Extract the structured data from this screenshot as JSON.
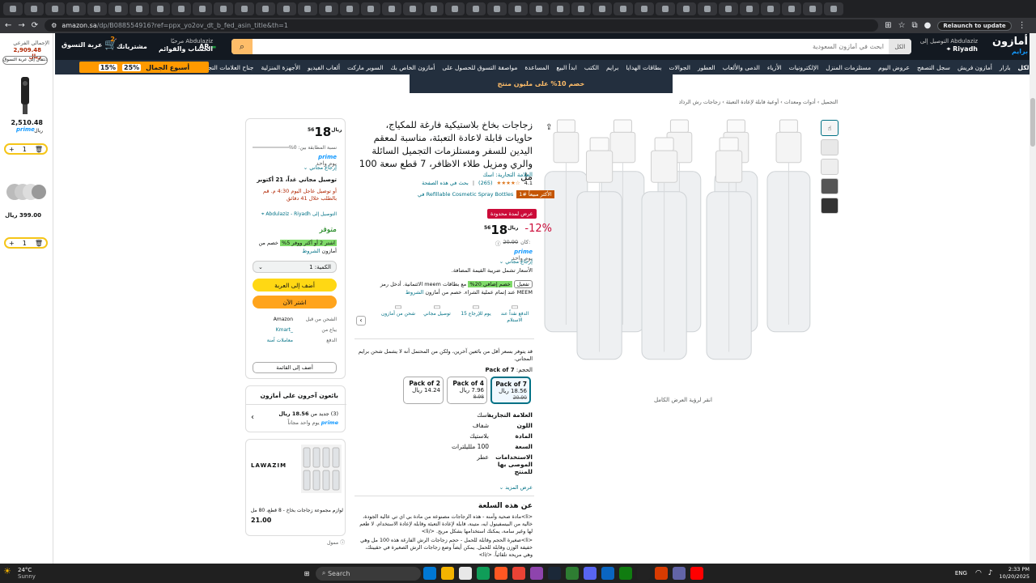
{
  "browser": {
    "url_host": "amazon.sa",
    "url_path": "/dp/B088554916?ref=ppx_yo2ov_dt_b_fed_asin_title&th=1",
    "relaunch": "Relaunch to update",
    "tab_count": 40
  },
  "header": {
    "logo": "أمازون",
    "prime_logo": "برايم",
    "deliver_to_line1": "التوصيل إلى Abdulaziz",
    "deliver_to_line2": "Riyadh",
    "search_placeholder": "ابحث في أمازون السعودية",
    "search_category": "الكل",
    "lang": "AR",
    "account_line1": "مرحبًا Abdulaziz",
    "account_line2": "الحساب والقوائم",
    "orders": "مشترياتك",
    "cart_label": "عربة التسوق",
    "cart_count": "2"
  },
  "nav": {
    "all": "الكل",
    "items": [
      "بازار",
      "أمازون فريش",
      "سجل التصفح",
      "عروض اليوم",
      "مستلزمات المنزل",
      "الإلكترونيات",
      "الأزياء",
      "الدمى والألعاب",
      "العطور",
      "الجوالات",
      "بطاقات الهدايا",
      "برايم",
      "الكتب",
      "ابدأ البيع",
      "المساعدة",
      "مواصفة التسوق للحصول على",
      "أمازون الخاص بك",
      "السوبر ماركت",
      "ألعاب الفيديو",
      "الأجهزة المنزلية",
      "جناح العلامات التجارية الدولية"
    ],
    "promo_title": "أسبوع الجمال",
    "promo_25": "25%",
    "promo_15": "15%"
  },
  "banner": "خصم 10% على مليون منتج",
  "breadcrumb": "التجميل › أدوات ومعدات › أوعية قابلة لإعادة التعبئة › زجاجات رش الرذاذ",
  "sidebar": {
    "subtotal_label": "الإجمالي الفرعي",
    "subtotal_value": "2,909.48 ريال",
    "go_to_cart": "الانتقال إلى عربة التسوق",
    "item1_price": "2,510.48",
    "item1_currency": "ريال",
    "item1_prime": "prime",
    "item1_qty": "1",
    "item2_price": "399.00 ريال",
    "item2_qty": "1"
  },
  "gallery": {
    "zoom_hint": "انقر لرؤية العرض الكامل"
  },
  "product": {
    "title": "زجاجات بخاخ بلاستيكية فارغة للمكياج، حاويات قابلة لاعادة التعبئة، مناسبة لمعقم اليدين للسفر ومستلزمات التجميل السائلة والري ومزيل طلاء الاظافر، 7 قطع سعة 100 مل",
    "brand_line": "العلامة التجارية: اسك",
    "rating": "4.1",
    "reviews": "(265)",
    "search_in_page": "بحث في هذه الصفحة",
    "best_seller_badge": "الأكثر مبيعاً #1",
    "best_seller_cat": "في Refillable Cosmetic Spray Bottles",
    "deal_badge": "عرض لمدة محدودة",
    "discount": "-12%",
    "price_int": "18",
    "price_frac": "56",
    "currency": "ريال",
    "was_label": "كان:",
    "was_price": "20.90",
    "prime": "prime",
    "prime_day": "يوم واحد",
    "free_returns": "إرجاع مجاني",
    "vat_note": "الأسعار تشمل ضريبة القيمة المضافة.",
    "card_offer_btn": "تفعيل",
    "card_offer_badge": "خصم إضافي 20%",
    "card_offer_text": "مع بطاقات meem الائتمانية. أدخل رمز",
    "card_offer_text2": "MEEM عند إتمام عملية الشراء. خصم من أمازون",
    "card_terms": "الشروط",
    "features": [
      "الدفع نقداً عند الاستلام",
      "15 يوم للإرجاع",
      "توصيل مجاني",
      "شحن من أمازون"
    ],
    "cheaper_note": "قد يتوفر بسعر أقل من بائعين آخرين، ولكن من المحتمل أنه لا يشمل شحن برايم المجاني.",
    "size_label": "الحجم:",
    "size_value": "Pack of 7",
    "packs": [
      {
        "name": "Pack of 7",
        "price": "18.56 ريال",
        "was": "20.90"
      },
      {
        "name": "Pack of 4",
        "price": "7.96 ريال",
        "was": "8.98"
      },
      {
        "name": "Pack of 2",
        "price": "14.24 ريال",
        "was": ""
      }
    ],
    "specs": [
      {
        "k": "العلامة التجارية",
        "v": "اسك"
      },
      {
        "k": "اللون",
        "v": "شفاف"
      },
      {
        "k": "المادة",
        "v": "بلاستيك"
      },
      {
        "k": "السعة",
        "v": "100 ملليلترات"
      },
      {
        "k": "الاستخدامات الموصى بها للمنتج",
        "v": "عطر"
      }
    ],
    "see_more": "عرض المزيد",
    "about_title": "عن هذه السلعة",
    "about_1": "<li>مادة صحية وآمنة - هذه الزجاجات مصنوعة من مادة بي اي تي عالية الجودة، خالية من البيسفينول ايه، متينة، قابلة لإعادة التعبئة وقابلة لإعادة الاستخدام. لا طعم لها وغير سامة، يمكنك استخدامها بشكل مريح. </li>",
    "about_2": "<li>صغيرة الحجم وقابلة للحمل - حجم زجاجات الرش الفارغة هذه 100 مل وهي خفيفة الوزن وقابلة للحمل. يمكن أيضاً وضع زجاجات الرش الصغيرة في حقيبتك، وهي مريحة تلقائياً. </li>"
  },
  "buybox": {
    "price_int": "18",
    "price_frac": "56",
    "currency": "ريال",
    "match_label": "نسبة المطابقة بين: 0%",
    "prime": "prime",
    "prime_day": "يوم واحد",
    "free_returns": "إرجاع مجاني",
    "delivery": "توصيل مجاني غداً، 21 أكتوبر",
    "fastest": "أو توصيل عاجل اليوم 4:30 م. قم بالطلب خلال 41 دقائق",
    "deliver_to": "التوصيل إلى Abdulaziz - Riyadh",
    "in_stock": "متوفر",
    "save_badge": "اشتر 2 أو أكثر ووفر 5%",
    "save_text": "خصم من أمازون",
    "save_terms": "الشروط",
    "qty_label": "الكمية:",
    "qty_value": "1",
    "add_to_cart": "أضف إلى العربة",
    "buy_now": "اشتر الآن",
    "ships_from_label": "الشحن من قبل",
    "ships_from": "Amazon",
    "sold_by_label": "يباع من",
    "sold_by": "Kmart_",
    "payment_label": "الدفع",
    "payment": "معاملات آمنة",
    "add_to_list": "أضف إلى القائمة",
    "other_sellers": "بائعون آخرون على أمازون",
    "other_count": "(3) جديد من",
    "other_price": "18.56 ريال",
    "other_prime": "يوم واحد مجاناً",
    "ad_brand": "LAWAZIM",
    "ad_title": "لوازم مجموعة زجاجات بخاخ - 8 قطع، 80 مل",
    "ad_price": "21.00",
    "ad_sponsored": "ممول"
  },
  "taskbar": {
    "weather": "24°C",
    "weather_desc": "Sunny",
    "search": "Search",
    "lang": "ENG",
    "time": "2:33 PM",
    "date": "10/20/2025"
  }
}
